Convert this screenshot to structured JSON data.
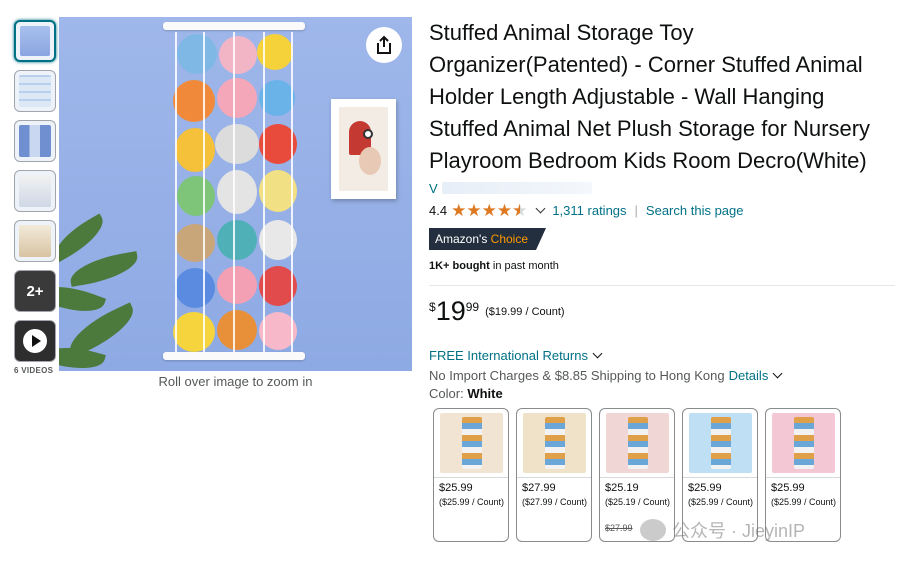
{
  "gallery": {
    "thumbnails": [
      {
        "name": "thumb-1",
        "selected": true
      },
      {
        "name": "thumb-2",
        "selected": false
      },
      {
        "name": "thumb-3",
        "selected": false
      },
      {
        "name": "thumb-4",
        "selected": false
      },
      {
        "name": "thumb-5",
        "selected": false
      }
    ],
    "more_label": "2+",
    "videos_label": "6 VIDEOS",
    "zoom_hint": "Roll over image to zoom in",
    "share_icon": "share-icon"
  },
  "product": {
    "title": "Stuffed Animal Storage Toy Organizer(Patented) - Corner Stuffed Animal Holder Length Adjustable - Wall Hanging Stuffed Animal Net Plush Storage for Nursery Playroom Bedroom Kids Room Decro(White)",
    "store_initial": "V",
    "rating": "4.4",
    "rating_value": 4.4,
    "ratings_count": "1,311 ratings",
    "search_page": "Search this page",
    "separator": "|",
    "badge_prefix": "Amazon's",
    "badge_choice": "Choice",
    "bought_bold": "1K+ bought",
    "bought_rest": "in past month",
    "price": {
      "currency": "$",
      "whole": "19",
      "fraction": "99",
      "unit": "($19.99 / Count)"
    },
    "returns": "FREE International Returns",
    "shipping_text": "No Import Charges & $8.85 Shipping to Hong Kong",
    "shipping_link": "Details",
    "color_label": "Color:",
    "color_value": "White"
  },
  "swatches": [
    {
      "price": "$25.99",
      "unit": "($25.99 / Count)",
      "old": "",
      "bg": "#f2e4d2"
    },
    {
      "price": "$27.99",
      "unit": "($27.99 / Count)",
      "old": "",
      "bg": "#efe2c8"
    },
    {
      "price": "$25.19",
      "unit": "($25.19 / Count)",
      "old": "$27.99",
      "bg": "#f1d6d6"
    },
    {
      "price": "$25.99",
      "unit": "($25.99 / Count)",
      "old": "",
      "bg": "#bfe0f4"
    },
    {
      "price": "$25.99",
      "unit": "($25.99 / Count)",
      "old": "",
      "bg": "#f3c7d3"
    }
  ],
  "watermark": "公众号 · JieyinIP",
  "colors": {
    "link": "#007185",
    "star": "#de7921",
    "badge_bg": "#232f3e",
    "badge_accent": "#ff9900",
    "image_bg": "#9fb7ea"
  }
}
